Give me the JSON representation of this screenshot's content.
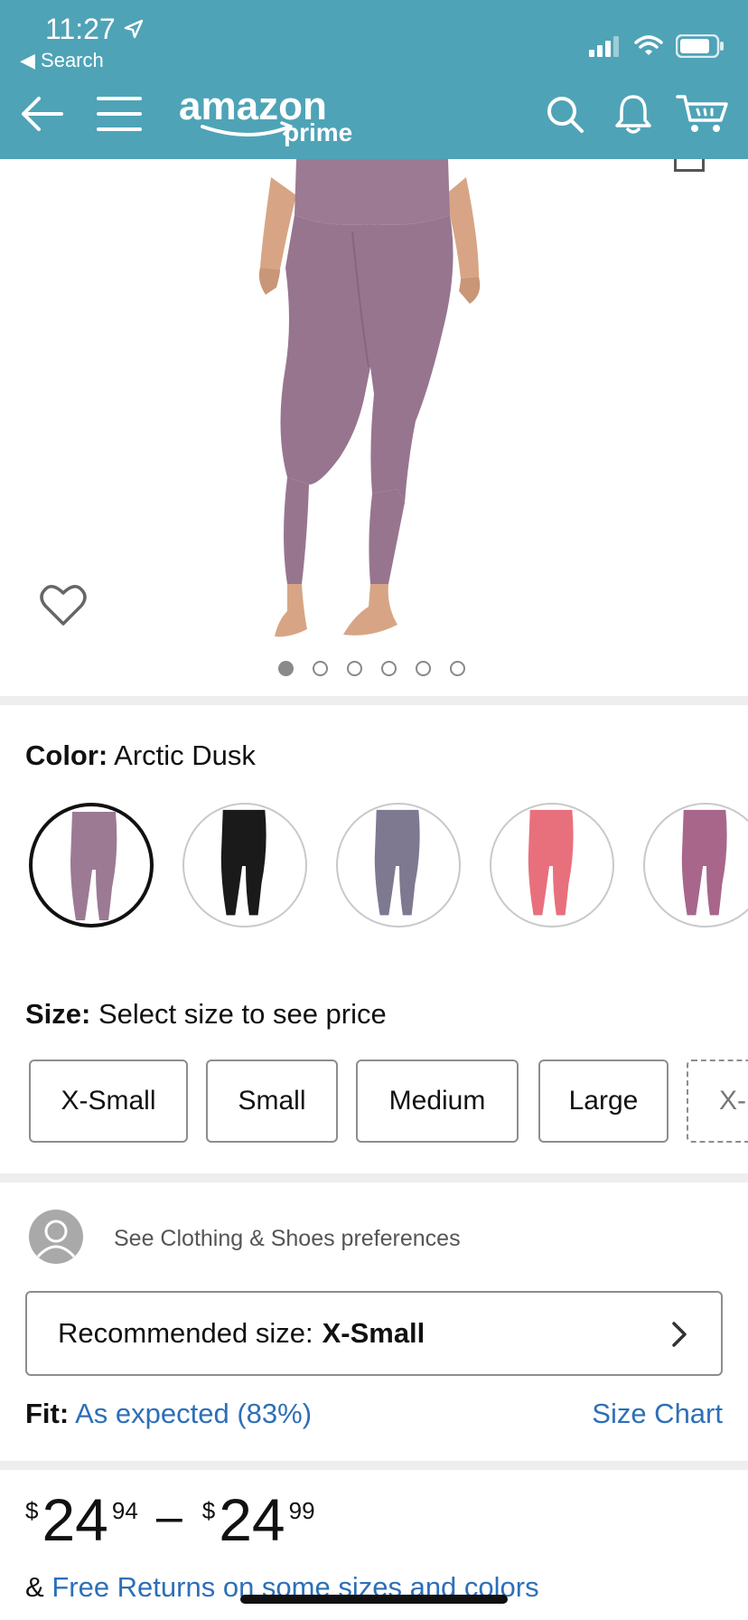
{
  "status_bar": {
    "time": "11:27",
    "back_label": "Search"
  },
  "header": {
    "brand": "amazon",
    "brand_sub": "prime",
    "bg_color": "#4fa3b7"
  },
  "gallery": {
    "image_count": 6,
    "active_index": 0
  },
  "color": {
    "label": "Color:",
    "selected": "Arctic Dusk",
    "swatches": [
      {
        "name": "Arctic Dusk",
        "hex": "#9c7a93"
      },
      {
        "name": "Black",
        "hex": "#1a1a1a"
      },
      {
        "name": "Gray",
        "hex": "#7f7891"
      },
      {
        "name": "Pink",
        "hex": "#e8707c"
      },
      {
        "name": "Mauve",
        "hex": "#a8668b"
      }
    ]
  },
  "size": {
    "label": "Size:",
    "prompt": "Select size to see price",
    "options": [
      "X-Small",
      "Small",
      "Medium",
      "Large",
      "X-"
    ]
  },
  "preferences": {
    "link_text": "See Clothing & Shoes preferences"
  },
  "recommended": {
    "label": "Recommended size:",
    "value": "X-Small"
  },
  "fit": {
    "label": "Fit:",
    "value": "As expected (83%)",
    "size_chart": "Size Chart"
  },
  "price": {
    "low_currency": "$",
    "low_whole": "24",
    "low_fraction": "94",
    "separator": "–",
    "high_currency": "$",
    "high_whole": "24",
    "high_fraction": "99"
  },
  "returns": {
    "prefix": "&",
    "link": "Free Returns on some sizes and colors"
  }
}
